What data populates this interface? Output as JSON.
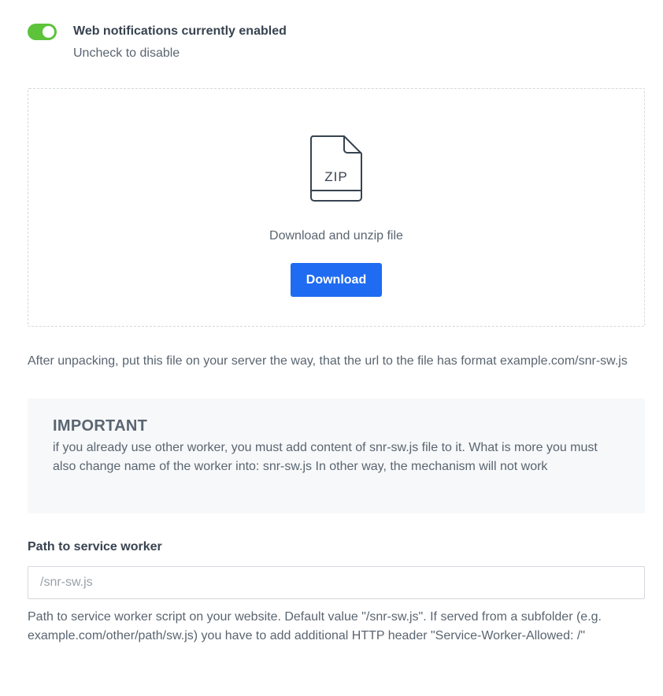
{
  "notifications": {
    "toggle_on": true,
    "title": "Web notifications currently enabled",
    "subtitle": "Uncheck to disable",
    "toggle_color": "#5cc33b"
  },
  "download": {
    "icon": "zip-file-icon",
    "icon_label": "ZIP",
    "text": "Download and unzip file",
    "button_label": "Download",
    "button_color": "#1f6bf2"
  },
  "instructions": {
    "text": "After unpacking, put this file on your server the way, that the url to the file has format example.com/snr-sw.js"
  },
  "important": {
    "title": "IMPORTANT",
    "body": "if you already use other worker, you must add content of snr-sw.js file to it. What is more you must also change name of the worker into: snr-sw.js In other way, the mechanism will not work"
  },
  "service_worker": {
    "label": "Path to service worker",
    "placeholder": "/snr-sw.js",
    "value": "",
    "help": "Path to service worker script on your website. Default value \"/snr-sw.js\". If served from a subfolder (e.g. example.com/other/path/sw.js) you have to add additional HTTP header \"Service-Worker-Allowed: /\""
  }
}
